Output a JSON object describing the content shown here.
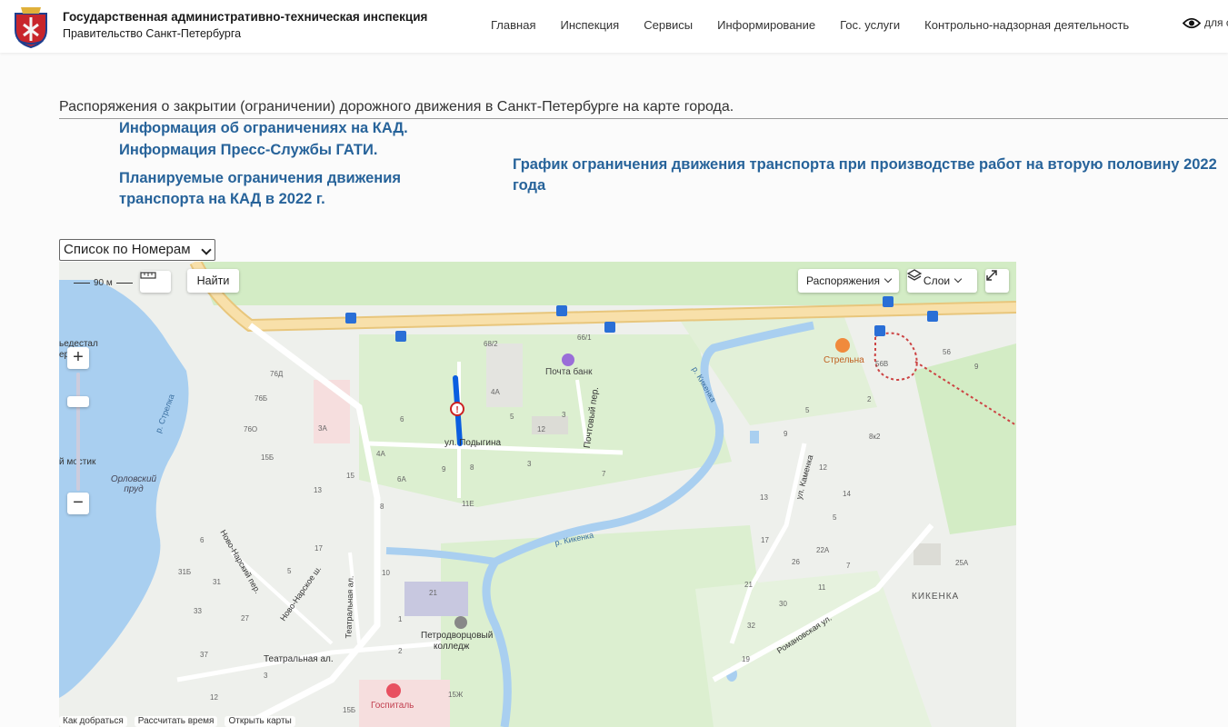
{
  "header": {
    "org_title": "Государственная административно-техническая инспекция",
    "org_subtitle": "Правительство Санкт-Петербурга",
    "nav": [
      "Главная",
      "Инспекция",
      "Сервисы",
      "Информирование",
      "Гос. услуги",
      "Контрольно-надзорная деятельность"
    ],
    "vision_label": "для с"
  },
  "main": {
    "heading": "Распоряжения о закрытии (ограничении) дорожного движения в Санкт-Петербурге на карте города.",
    "links": {
      "kad_info": "Информация об ограничениях на КАД.",
      "press_info": "Информация Пресс-Службы ГАТИ.",
      "kad_plan_line1": "Планируемые ограничения движения",
      "kad_plan_line2": "транспорта на КАД в 2022 г.",
      "schedule": "График ограничения движения транспорта при производстве работ на вторую половину 2022 года"
    },
    "select_value": "Список по Номерам"
  },
  "map": {
    "scale_label": "90 м",
    "find_button": "Найти",
    "orders_button": "Распоряжения",
    "layers_button": "Слои",
    "bottom_items": [
      "Как добраться",
      "Рассчитать время",
      "Открыть карты"
    ],
    "labels": {
      "pedestal": "ьедестал",
      "pedestal2": "ера",
      "bank": "Почта банк",
      "street_podygina": "ул. Подыгина",
      "pochtoviy": "Почтовый пер.",
      "strelna": "Стрельна",
      "kikenka_river": "р. Кикенка",
      "kikenka_river2": "р. Кикенка",
      "kikenka": "КИКЕНКА",
      "orlov_pond": "Орловский пруд",
      "strelka": "р. Стрелка",
      "mostik": "й мостик",
      "novonarsk": "Ново-Нарский пер.",
      "novonarsk_sh": "Ново-Нарское ш.",
      "teatralnaya_al": "Театральная ал.",
      "teatralnaya_al2": "Театральная ал.",
      "college1": "Петродворцовый",
      "college2": "колледж",
      "hospital": "Госпиталь",
      "kamenka": "ул. Каменка",
      "romanovskaya": "Романовская ул."
    },
    "house_numbers": [
      "68/2",
      "66/1",
      "4А",
      "5",
      "3",
      "12",
      "6",
      "76Д",
      "76Б",
      "76О",
      "3А",
      "15Б",
      "15",
      "13",
      "4А",
      "6А",
      "9",
      "8",
      "3",
      "7",
      "11Е",
      "8",
      "56В",
      "56",
      "9",
      "5",
      "2",
      "9",
      "8к2",
      "12",
      "14",
      "5",
      "13",
      "17",
      "22А",
      "26",
      "7",
      "21",
      "11",
      "30",
      "32",
      "19",
      "25А",
      "6",
      "31Б",
      "31",
      "33",
      "27",
      "37",
      "3",
      "12",
      "1",
      "5",
      "17",
      "10",
      "21",
      "2",
      "15Ж",
      "15Б"
    ],
    "colors": {
      "road_highlight": "#0a5ee0",
      "water": "#a9cff0",
      "green": "#d3ecc5",
      "road_main": "#f3d79a"
    }
  }
}
